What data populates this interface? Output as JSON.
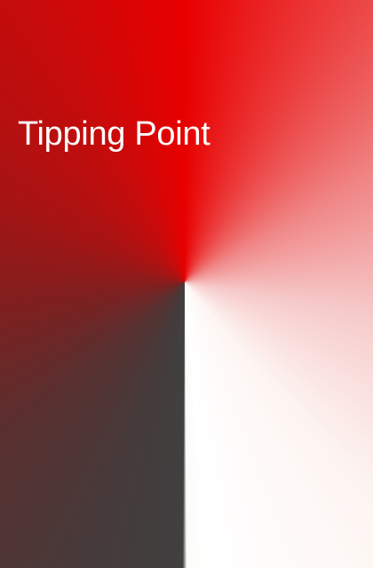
{
  "cover": {
    "title": "Tipping Point"
  },
  "colors": {
    "primary_red": "#e80000",
    "dark_gray": "#404040",
    "off_white": "#fdf5f2",
    "title_text": "#ffffff"
  }
}
